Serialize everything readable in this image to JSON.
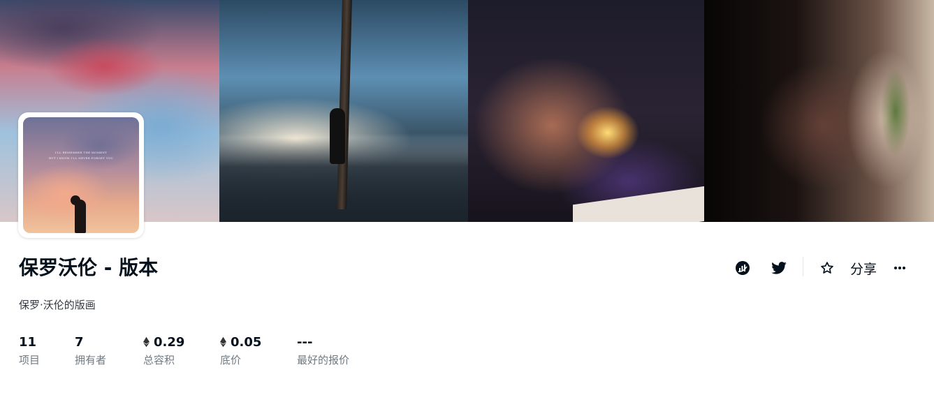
{
  "banner": {
    "images": [
      {
        "name": "pink-cloud-sky-icon"
      },
      {
        "name": "beach-pole-figure-icon"
      },
      {
        "name": "man-lighting-cigarette-icon"
      },
      {
        "name": "woman-smoking-silhouette-icon"
      }
    ]
  },
  "avatar": {
    "line1": "I'LL REMEMBER THE MOMENT",
    "line2": "BUT I KNOW I'LL NEVER FORGET YOU"
  },
  "collection": {
    "title": "保罗沃伦 - 版本",
    "description": "保罗·沃伦的版画"
  },
  "stats": [
    {
      "value": "11",
      "label": "项目",
      "eth": false
    },
    {
      "value": "7",
      "label": "拥有者",
      "eth": false
    },
    {
      "value": "0.29",
      "label": "总容积",
      "eth": true
    },
    {
      "value": "0.05",
      "label": "底价",
      "eth": true
    },
    {
      "value": "---",
      "label": "最好的报价",
      "eth": false
    }
  ],
  "actions": {
    "site_icon": "chart-logo-icon",
    "twitter_icon": "twitter-icon",
    "favorite_icon": "star-icon",
    "share_label": "分享",
    "more_icon": "more-dots-icon"
  },
  "colors": {
    "text_primary": "#04111d",
    "text_secondary": "#707a83",
    "divider": "#e5e8eb"
  }
}
